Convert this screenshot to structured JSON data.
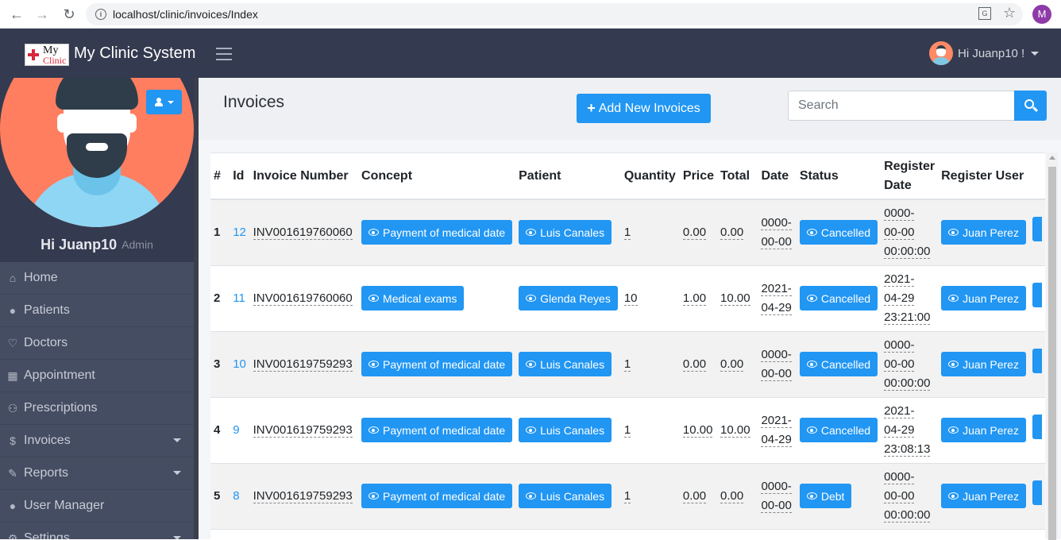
{
  "browser": {
    "url": "localhost/clinic/invoices/Index",
    "profile_initial": "M"
  },
  "topnav": {
    "logo_line1": "My",
    "logo_line2": "Clinic",
    "brand": "My Clinic System",
    "user": "Hi Juanp10 !"
  },
  "sidebar": {
    "greeting": "Hi Juanp10",
    "role": "Admin",
    "items": [
      {
        "label": "Home",
        "icon": "home-icon"
      },
      {
        "label": "Patients",
        "icon": "user-plus-icon"
      },
      {
        "label": "Doctors",
        "icon": "heartbeat-icon"
      },
      {
        "label": "Appointment",
        "icon": "calendar-icon"
      },
      {
        "label": "Prescriptions",
        "icon": "capsules-icon"
      },
      {
        "label": "Invoices",
        "icon": "dollar-icon"
      },
      {
        "label": "Reports",
        "icon": "edit-icon"
      },
      {
        "label": "User Manager",
        "icon": "users-icon"
      },
      {
        "label": "Settings",
        "icon": "gear-icon"
      }
    ]
  },
  "page": {
    "title": "Invoices",
    "add_button": "Add New Invoices",
    "search_placeholder": "Search"
  },
  "table": {
    "headers": [
      "#",
      "Id",
      "Invoice Number",
      "Concept",
      "Patient",
      "Quantity",
      "Price",
      "Total",
      "Date",
      "Status",
      "Register Date",
      "Register User"
    ],
    "rows": [
      {
        "n": "1",
        "id": "12",
        "invoice": "INV001619760060",
        "concept": "Payment of medical date",
        "patient": "Luis Canales",
        "qty": "1",
        "price": "0.00",
        "total": "0.00",
        "date1": "0000-",
        "date2": "00-00",
        "status": "Cancelled",
        "reg1": "0000-",
        "reg2": "00-00",
        "reg3": "00:00:00",
        "user": "Juan Perez"
      },
      {
        "n": "2",
        "id": "11",
        "invoice": "INV001619760060",
        "concept": "Medical exams",
        "patient": "Glenda Reyes",
        "qty": "10",
        "price": "1.00",
        "total": "10.00",
        "date1": "2021-",
        "date2": "04-29",
        "status": "Cancelled",
        "reg1": "2021-",
        "reg2": "04-29",
        "reg3": "23:21:00",
        "user": "Juan Perez"
      },
      {
        "n": "3",
        "id": "10",
        "invoice": "INV001619759293",
        "concept": "Payment of medical date",
        "patient": "Luis Canales",
        "qty": "1",
        "price": "0.00",
        "total": "0.00",
        "date1": "0000-",
        "date2": "00-00",
        "status": "Cancelled",
        "reg1": "0000-",
        "reg2": "00-00",
        "reg3": "00:00:00",
        "user": "Juan Perez"
      },
      {
        "n": "4",
        "id": "9",
        "invoice": "INV001619759293",
        "concept": "Payment of medical date",
        "patient": "Luis Canales",
        "qty": "1",
        "price": "10.00",
        "total": "10.00",
        "date1": "2021-",
        "date2": "04-29",
        "status": "Cancelled",
        "reg1": "2021-",
        "reg2": "04-29",
        "reg3": "23:08:13",
        "user": "Juan Perez"
      },
      {
        "n": "5",
        "id": "8",
        "invoice": "INV001619759293",
        "concept": "Payment of medical date",
        "patient": "Luis Canales",
        "qty": "1",
        "price": "0.00",
        "total": "0.00",
        "date1": "0000-",
        "date2": "00-00",
        "status": "Debt",
        "reg1": "0000-",
        "reg2": "00-00",
        "reg3": "00:00:00",
        "user": "Juan Perez"
      }
    ]
  },
  "colors": {
    "accent": "#2196f3",
    "navbar": "#343a4f",
    "sidebar": "#454d62"
  }
}
